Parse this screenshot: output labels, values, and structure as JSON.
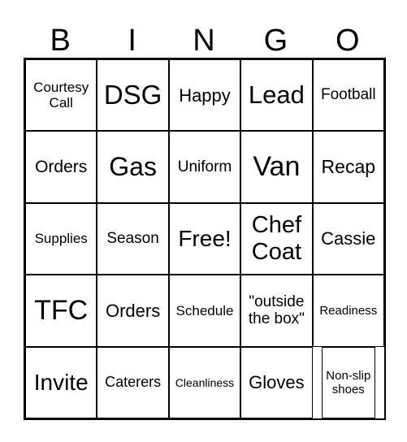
{
  "header": [
    "B",
    "I",
    "N",
    "G",
    "O"
  ],
  "cells": [
    [
      "Courtesy Call",
      "DSG",
      "Happy",
      "Lead",
      "Football"
    ],
    [
      "Orders",
      "Gas",
      "Uniform",
      "Van",
      "Recap"
    ],
    [
      "Supplies",
      "Season",
      "Free!",
      "Chef Coat",
      "Cassie"
    ],
    [
      "TFC",
      "Orders",
      "Schedule",
      "\"outside the box\"",
      "Readiness"
    ],
    [
      "Invite",
      "Caterers",
      "Cleanliness",
      "Gloves",
      "Non-slip shoes"
    ]
  ]
}
